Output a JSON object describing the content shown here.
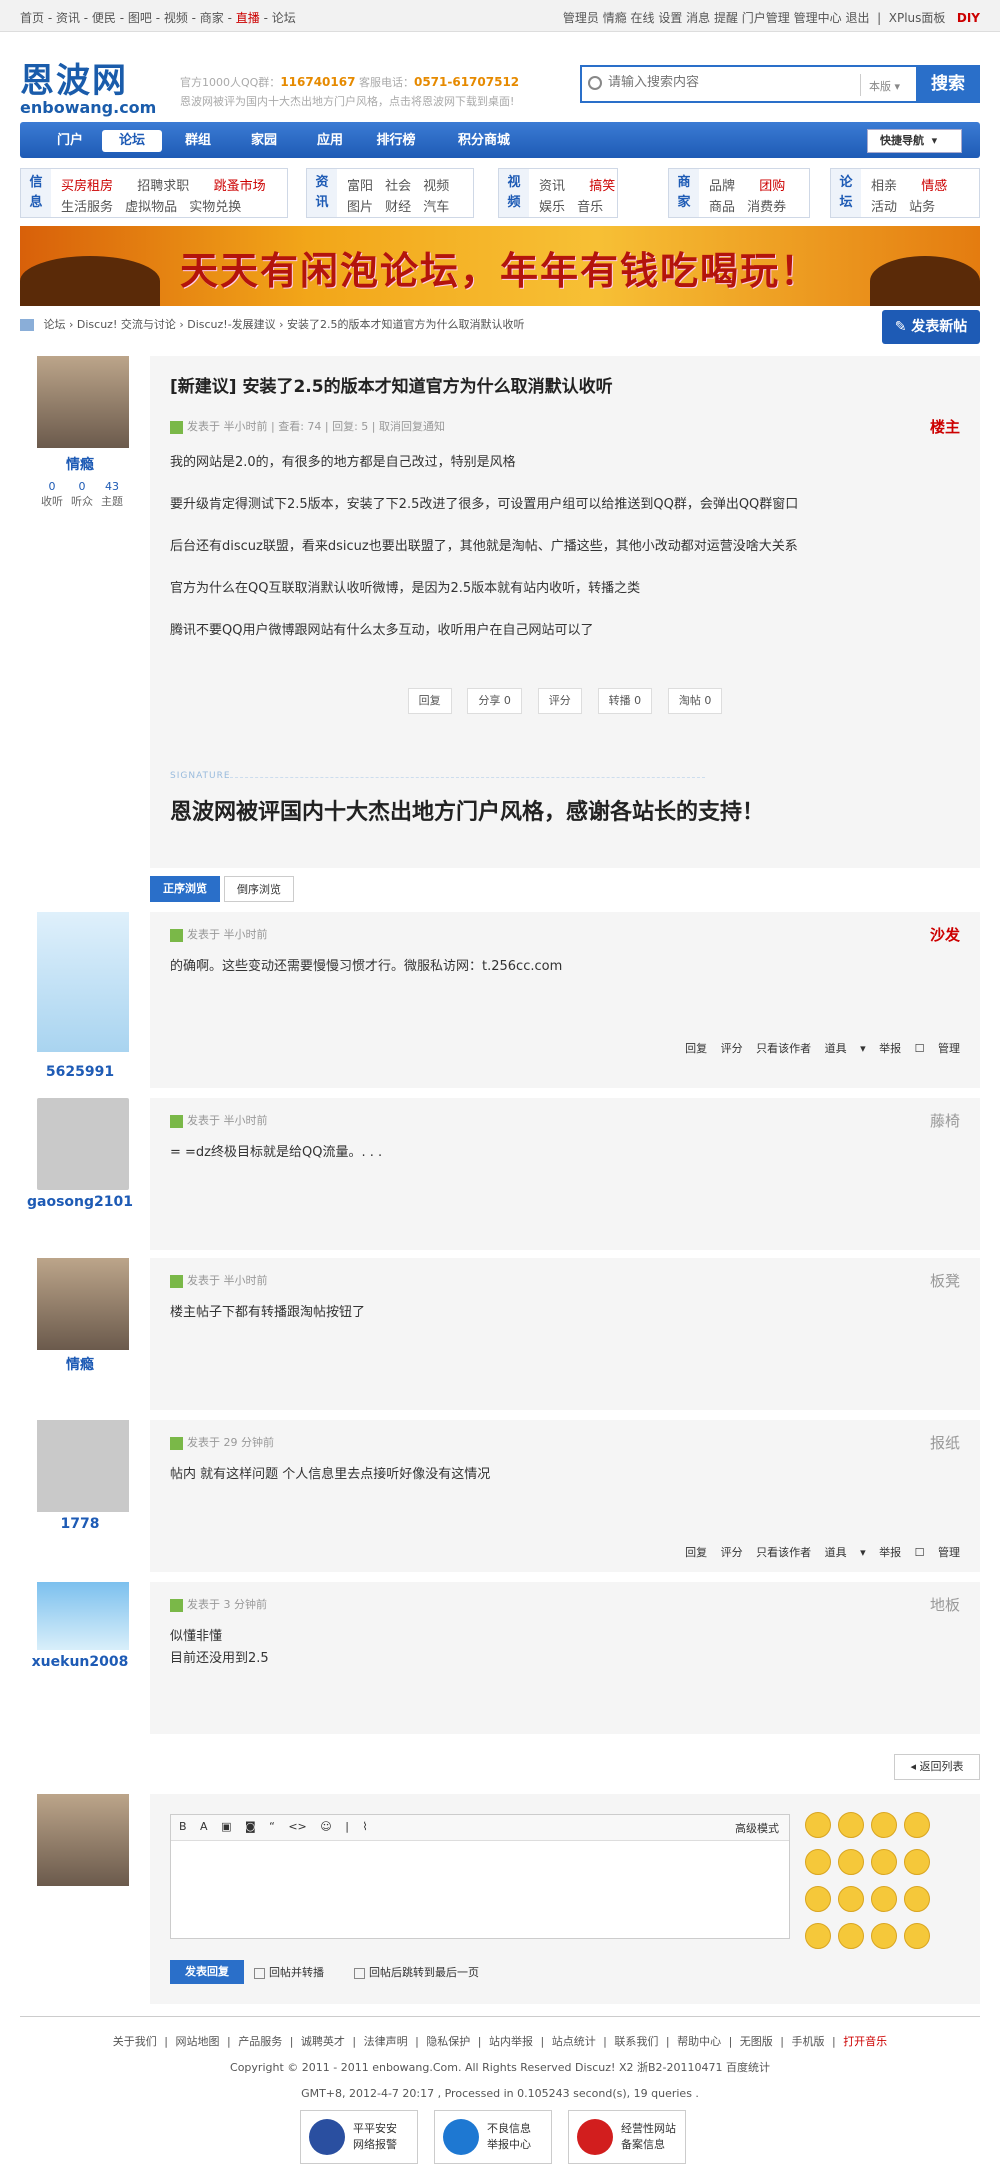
{
  "topbar": {
    "left": [
      "首页",
      "资讯",
      "便民",
      "图吧",
      "视频",
      "商家",
      "直播",
      "论坛"
    ],
    "left_text": "首页 - 资讯 - 便民 - 图吧 - 视频 - 商家 - ",
    "live": "直播",
    "left_end": " - 论坛",
    "right": "管理员  情瘾  在线  设置  消息  提醒  门户管理  管理中心  退出",
    "xplus": "XPlus面板",
    "diy": "DIY"
  },
  "header": {
    "logo_cn": "恩波网",
    "logo_en": "enbowang.com",
    "qq_label": "官方1000人QQ群：",
    "qq": "116740167",
    "tel_label": " 客服电话：",
    "tel": "0571-61707512",
    "slogan": "恩波网被评为国内十大杰出地方门户风格，点击将恩波网下载到桌面!",
    "search_placeholder": "请输入搜索内容",
    "search_scope": "本版",
    "search_btn": "搜索"
  },
  "nav": {
    "items": [
      "门户",
      "论坛",
      "群组",
      "家园",
      "应用",
      "排行榜",
      "积分商城"
    ],
    "quick": "快捷导航"
  },
  "cats": [
    {
      "h1": "信",
      "h2": "息",
      "l1a": "买房租房",
      "l1b": "招聘求职",
      "l1c": "跳蚤市场",
      "l2": "生活服务  虚拟物品  实物兑换"
    },
    {
      "h1": "资",
      "h2": "讯",
      "l1": "富阳  社会  视频",
      "l2": "图片  财经  汽车"
    },
    {
      "h1": "视",
      "h2": "频",
      "l1a": "资讯",
      "l1b": "搞笑",
      "l2": "娱乐  音乐"
    },
    {
      "h1": "商",
      "h2": "家",
      "l1a": "品牌",
      "l1b": "团购",
      "l2": "商品  消费券"
    },
    {
      "h1": "论",
      "h2": "坛",
      "l1a": "相亲",
      "l1b": "情感",
      "l2": "活动  站务"
    }
  ],
  "banner": {
    "text": "天天有闲泡论坛，年年有钱吃喝玩！"
  },
  "crumb": {
    "items": "论坛  ›  Discuz! 交流与讨论  ›  Discuz!-发展建议  ›  安装了2.5的版本才知道官方为什么取消默认收听",
    "newpost": "发表新帖"
  },
  "op": {
    "user": "情瘾",
    "stats": [
      "0",
      "0",
      "43"
    ],
    "stat_labels": [
      "收听",
      "听众",
      "主题"
    ],
    "title": "[新建议] 安装了2.5的版本才知道官方为什么取消默认收听",
    "meta": "发表于 半小时前  |  查看: 74  |  回复: 5  |  取消回复通知",
    "floor": "楼主",
    "body": [
      "我的网站是2.0的，有很多的地方都是自己改过，特别是风格",
      "要升级肯定得测试下2.5版本，安装了下2.5改进了很多，可设置用户组可以给推送到QQ群，会弹出QQ群窗口",
      "后台还有discuz联盟，看来dsicuz也要出联盟了，其他就是淘帖、广播这些，其他小改动都对运营没啥大关系",
      "官方为什么在QQ互联取消默认收听微博，是因为2.5版本就有站内收听，转播之类",
      "腾讯不要QQ用户微博跟网站有什么太多互动，收听用户在自己网站可以了"
    ],
    "actions": [
      "回复",
      "分享 0",
      "评分",
      "转播 0",
      "淘帖 0"
    ],
    "sig_label": "SIGNATURE",
    "signature": "恩波网被评国内十大杰出地方门户风格，感谢各站长的支持！"
  },
  "tabs": {
    "on": "正序浏览",
    "off": "倒序浏览"
  },
  "replies": [
    {
      "user": "5625991",
      "meta": "发表于 半小时前",
      "floor": "沙发",
      "body": [
        "的确啊。这些变动还需要慢慢习惯才行。微服私访网：t.256cc.com"
      ],
      "tools": "回复  评分  只看该作者  道具 ▾  举报 ☐ 管理"
    },
    {
      "user": "gaosong2101",
      "meta": "发表于 半小时前",
      "floor": "藤椅",
      "body": [
        "= =dz终极目标就是给QQ流量。. . ."
      ],
      "tools": ""
    },
    {
      "user": "情瘾",
      "meta": "发表于 半小时前",
      "floor": "板凳",
      "body": [
        "楼主帖子下都有转播跟淘帖按钮了"
      ],
      "tools": ""
    },
    {
      "user": "1778",
      "meta": "发表于 29 分钟前",
      "floor": "报纸",
      "body": [
        "帖内 就有这样问题 个人信息里去点接听好像没有这情况"
      ],
      "tools": "回复  评分  只看该作者  道具 ▾  举报 ☐ 管理"
    },
    {
      "user": "xuekun2008",
      "meta": "发表于 3 分钟前",
      "floor": "地板",
      "body": [
        "似懂非懂",
        "目前还没用到2.5"
      ],
      "tools": ""
    }
  ],
  "backlist": "返回列表",
  "reply": {
    "toolbar": "B  A  ▣  ◙  “  <>  ☺  |  ⌇",
    "advanced": "高级模式",
    "submit": "发表回复",
    "opt1": "回帖并转播",
    "opt2": "回帖后跳转到最后一页"
  },
  "footer": {
    "links": "关于我们 | 网站地图 | 产品服务 | 诚聘英才 | 法律声明 | 隐私保护 | 站内举报 | 站点统计 | 联系我们 | 帮助中心 | 无图版 | 手机版 | ",
    "music": "打开音乐",
    "copyright": "Copyright © 2011 - 2011 enbowang.Com. All Rights Reserved Discuz! X2 浙B2-20110471 百度统计",
    "gmt": "GMT+8, 2012-4-7 20:17 , Processed in 0.105243 second(s), 19 queries .",
    "badges": [
      [
        "平平安安",
        "网络报警"
      ],
      [
        "不良信息",
        "举报中心"
      ],
      [
        "经营性网站",
        "备案信息"
      ]
    ]
  }
}
